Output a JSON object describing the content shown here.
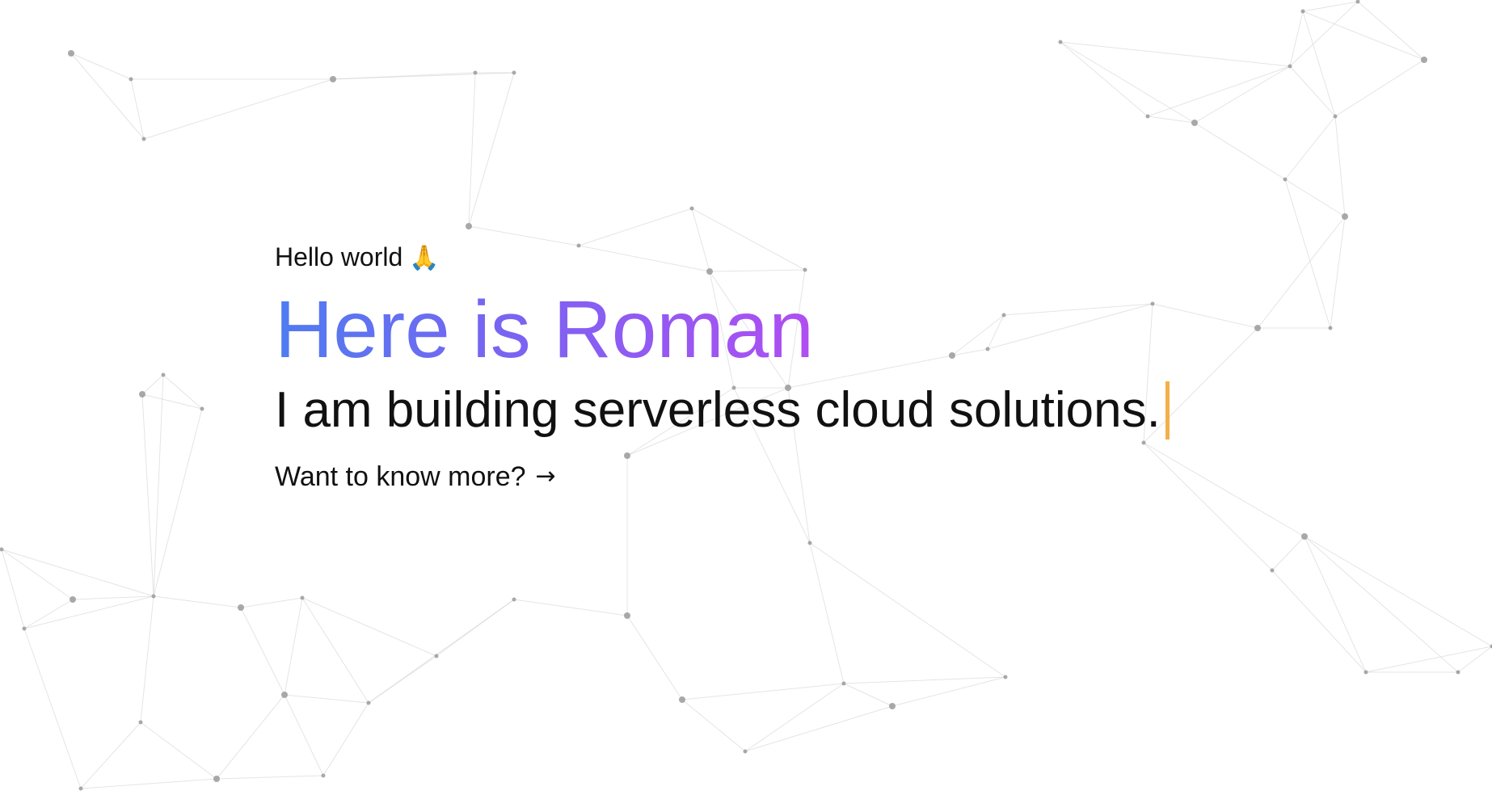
{
  "hero": {
    "greeting": "Hello world",
    "greeting_emoji": "🙏",
    "headline": "Here is Roman",
    "tagline": "I am building serverless cloud solutions.",
    "cta_label": "Want to know more?",
    "cta_arrow": "→"
  },
  "icons": {
    "greeting_emoji": "folded-hands-icon",
    "cta_arrow": "arrow-right-icon",
    "caret": "text-cursor"
  },
  "colors": {
    "headline_gradient_start": "#4f7cf0",
    "headline_gradient_end": "#b04ef2",
    "caret": "#f3b04a",
    "text": "#111111",
    "network_lines": "#cfcfcf",
    "network_nodes": "#9a9a9a"
  }
}
